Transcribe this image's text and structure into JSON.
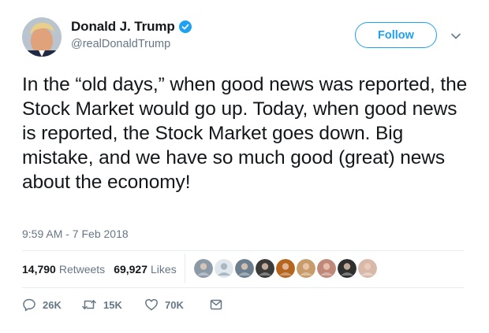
{
  "user": {
    "display_name": "Donald J. Trump",
    "handle": "@realDonaldTrump",
    "verified": true
  },
  "follow_label": "Follow",
  "tweet": {
    "text": "In the “old days,” when good news was reported, the Stock Market would go up. Today, when good news is reported, the Stock Market goes down. Big mistake, and we have so much good (great) news about the economy!",
    "timestamp": "9:59 AM - 7 Feb 2018"
  },
  "stats": {
    "retweets_count": "14,790",
    "retweets_label": "Retweets",
    "likes_count": "69,927",
    "likes_label": "Likes"
  },
  "liker_avatars": [
    {
      "icon": "user-avatar-icon",
      "color": "#8a9aa6"
    },
    {
      "icon": "default-avatar-icon",
      "color": "#aab8c2"
    },
    {
      "icon": "user-avatar-icon",
      "color": "#6b7f8e"
    },
    {
      "icon": "user-avatar-icon",
      "color": "#3a3a3a"
    },
    {
      "icon": "user-avatar-icon",
      "color": "#b5651d"
    },
    {
      "icon": "user-avatar-icon",
      "color": "#c89c6a"
    },
    {
      "icon": "user-avatar-icon",
      "color": "#c08878"
    },
    {
      "icon": "user-avatar-icon",
      "color": "#2f2f2f"
    },
    {
      "icon": "user-avatar-icon",
      "color": "#d8b8a8"
    }
  ],
  "actions": {
    "replies": "26K",
    "retweets": "15K",
    "likes": "70K"
  },
  "colors": {
    "accent": "#1da1f2",
    "text": "#14171a",
    "secondary": "#657786",
    "divider": "#e6ecf0"
  }
}
